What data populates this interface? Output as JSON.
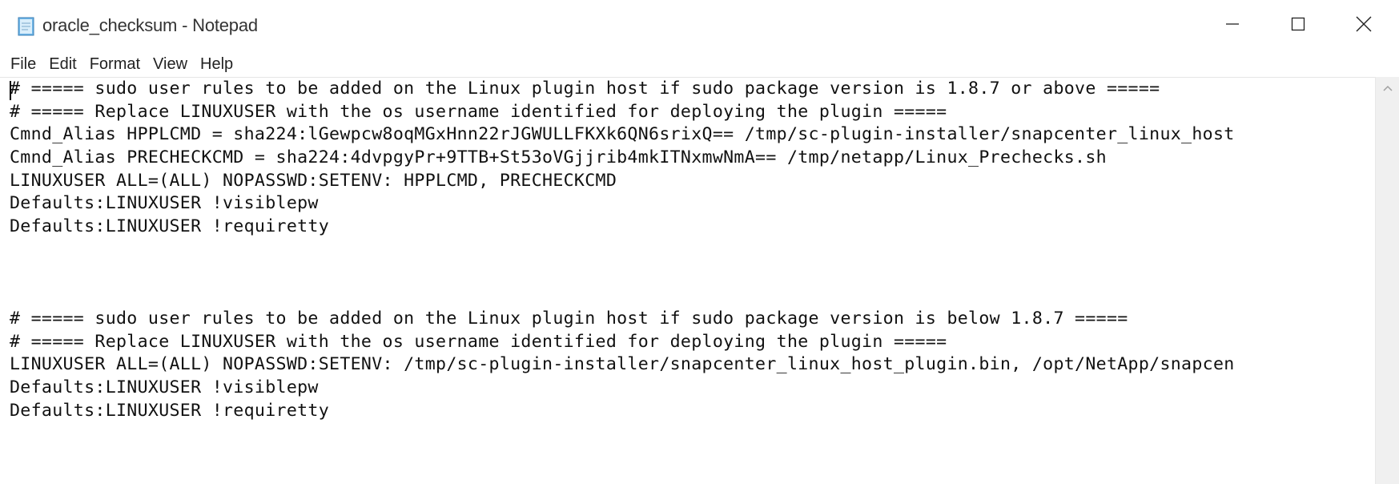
{
  "window": {
    "title": "oracle_checksum - Notepad",
    "icons": {
      "app": "notepad-icon",
      "minimize": "minimize-icon",
      "maximize": "maximize-icon",
      "close": "close-icon"
    }
  },
  "menu": [
    {
      "label": "File"
    },
    {
      "label": "Edit"
    },
    {
      "label": "Format"
    },
    {
      "label": "View"
    },
    {
      "label": "Help"
    }
  ],
  "editor": {
    "lines": [
      "# ===== sudo user rules to be added on the Linux plugin host if sudo package version is 1.8.7 or above =====",
      "# ===== Replace LINUXUSER with the os username identified for deploying the plugin =====",
      "Cmnd_Alias HPPLCMD = sha224:lGewpcw8oqMGxHnn22rJGWULLFKXk6QN6srixQ== /tmp/sc-plugin-installer/snapcenter_linux_host",
      "Cmnd_Alias PRECHECKCMD = sha224:4dvpgyPr+9TTB+St53oVGjjrib4mkITNxmwNmA== /tmp/netapp/Linux_Prechecks.sh",
      "LINUXUSER ALL=(ALL) NOPASSWD:SETENV: HPPLCMD, PRECHECKCMD",
      "Defaults:LINUXUSER !visiblepw",
      "Defaults:LINUXUSER !requiretty",
      "",
      "",
      "",
      "# ===== sudo user rules to be added on the Linux plugin host if sudo package version is below 1.8.7 =====",
      "# ===== Replace LINUXUSER with the os username identified for deploying the plugin =====",
      "LINUXUSER ALL=(ALL) NOPASSWD:SETENV: /tmp/sc-plugin-installer/snapcenter_linux_host_plugin.bin, /opt/NetApp/snapcen",
      "Defaults:LINUXUSER !visiblepw",
      "Defaults:LINUXUSER !requiretty"
    ]
  },
  "scrollbar": {
    "up_icon": "scroll-up-arrow-icon"
  }
}
